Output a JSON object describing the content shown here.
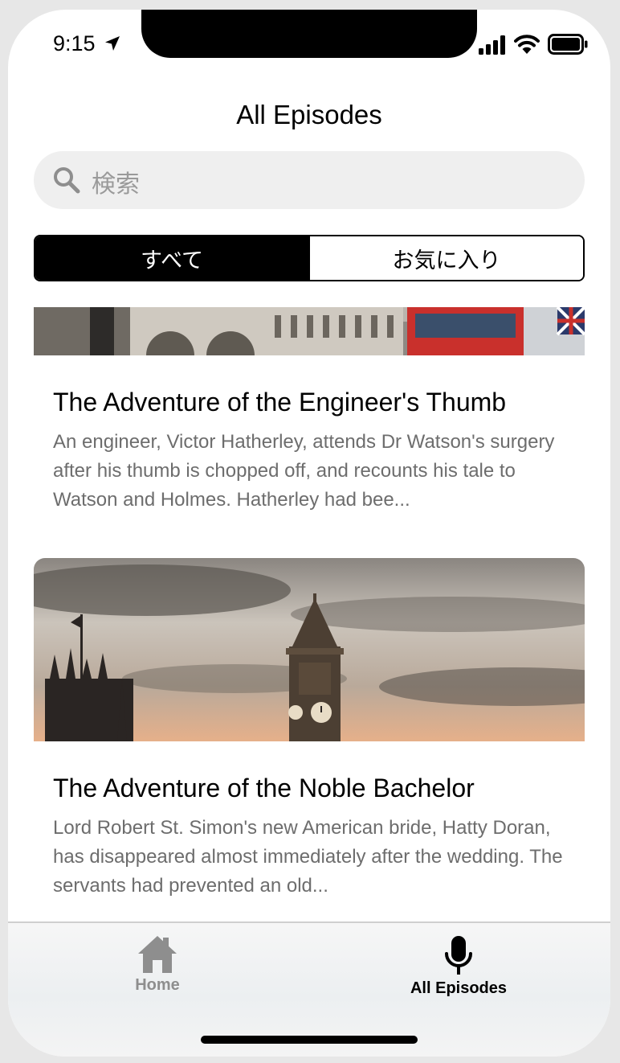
{
  "status_bar": {
    "time": "9:15"
  },
  "nav": {
    "title": "All Episodes"
  },
  "search": {
    "placeholder": "検索"
  },
  "segments": [
    {
      "label": "すべて",
      "selected": true
    },
    {
      "label": "お気に入り",
      "selected": false
    }
  ],
  "episodes": [
    {
      "title": "The Adventure of the Engineer's Thumb",
      "description": "An engineer, Victor Hatherley, attends Dr Watson's surgery after his thumb is chopped off, and recounts his tale to Watson and Holmes. Hatherley had bee..."
    },
    {
      "title": "The Adventure of the Noble Bachelor",
      "description": "Lord Robert St. Simon's new American bride, Hatty Doran, has disappeared almost immediately after the wedding. The servants had prevented an old..."
    }
  ],
  "tabbar": {
    "tabs": [
      {
        "label": "Home",
        "icon": "home-icon",
        "active": false
      },
      {
        "label": "All Episodes",
        "icon": "microphone-icon",
        "active": true
      }
    ]
  },
  "colors": {
    "accent": "#000000",
    "inactive_tab": "#8e8e8e",
    "description": "#6d6d6d"
  }
}
